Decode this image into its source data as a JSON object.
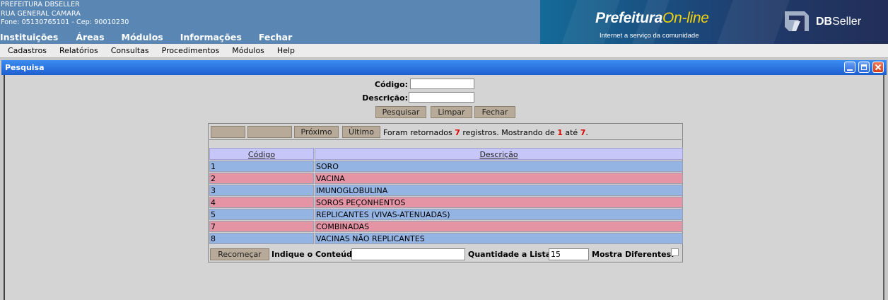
{
  "header": {
    "org_name": "PREFEITURA DBSELLER",
    "address": "RUA GENERAL CAMARA",
    "contact": "Fone: 05130765101  -  Cep: 90010230",
    "menu": [
      "Instituições",
      "Áreas",
      "Módulos",
      "Informações",
      "Fechar"
    ],
    "brand_title": "Prefeitura",
    "brand_title_accent": "On-line",
    "brand_subtitle": "Internet a serviço da comunidade",
    "company_bold": "DB",
    "company_rest": "Seller"
  },
  "submenu": [
    "Cadastros",
    "Relatórios",
    "Consultas",
    "Procedimentos",
    "Módulos",
    "Help"
  ],
  "window": {
    "title": "Pesquisa"
  },
  "search": {
    "codigo_label": "Código:",
    "codigo_value": "",
    "descricao_label": "Descrição:",
    "descricao_value": "",
    "pesquisar_label": "Pesquisar",
    "limpar_label": "Limpar",
    "fechar_label": "Fechar"
  },
  "results": {
    "nav": {
      "first_label": "",
      "prev_label": "",
      "next_label": "Próximo",
      "last_label": "Último"
    },
    "status_prefix": "Foram retornados ",
    "status_count": "7",
    "status_mid": " registros. Mostrando de ",
    "status_from": "1",
    "status_to_word": " até ",
    "status_to": "7",
    "status_end": ".",
    "columns": [
      "Código",
      "Descrição"
    ],
    "rows": [
      {
        "codigo": "1",
        "descricao": "SORO"
      },
      {
        "codigo": "2",
        "descricao": "VACINA"
      },
      {
        "codigo": "3",
        "descricao": "IMUNOGLOBULINA"
      },
      {
        "codigo": "4",
        "descricao": "SOROS PEÇONHENTOS"
      },
      {
        "codigo": "5",
        "descricao": "REPLICANTES (VIVAS-ATENUADAS)"
      },
      {
        "codigo": "7",
        "descricao": "COMBINADAS"
      },
      {
        "codigo": "8",
        "descricao": "VACINAS NÃO REPLICANTES"
      }
    ],
    "footer": {
      "recomecar_label": "Recomeçar",
      "conteudo_label": "Indique o Conteúdo:",
      "conteudo_value": "",
      "quantidade_label": "Quantidade a Listar:",
      "quantidade_value": "15",
      "mostra_label": "Mostra Diferentes:",
      "mostra_checked": false
    }
  },
  "colors": {
    "row_blue": "#94b4e4",
    "row_pink": "#e494a4",
    "header_blue": "#5a86b3",
    "title_bar": "#1e5fd0"
  }
}
